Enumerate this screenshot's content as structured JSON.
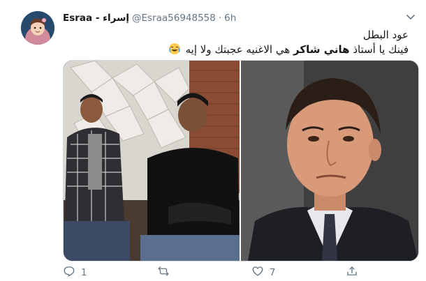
{
  "tweet": {
    "display_name": "Esraa - إسراء",
    "handle": "@Esraa56948558",
    "separator": "·",
    "time": "6h",
    "text_line1": "عود البطل",
    "text_line2_prefix": "فينك يا أستاذ ",
    "text_line2_bold": "هاني شاكر",
    "text_line2_suffix": " هي الاغنيه عجبتك ولا إيه",
    "emoji": "face-with-tears-of-joy"
  },
  "actions": {
    "reply_count": "1",
    "retweet_count": "",
    "like_count": "7"
  },
  "colors": {
    "text_primary": "#14171a",
    "text_secondary": "#657786",
    "border": "#cfd9de"
  },
  "icons": [
    "chevron-down-icon",
    "reply-icon",
    "retweet-icon",
    "like-icon",
    "share-icon"
  ]
}
